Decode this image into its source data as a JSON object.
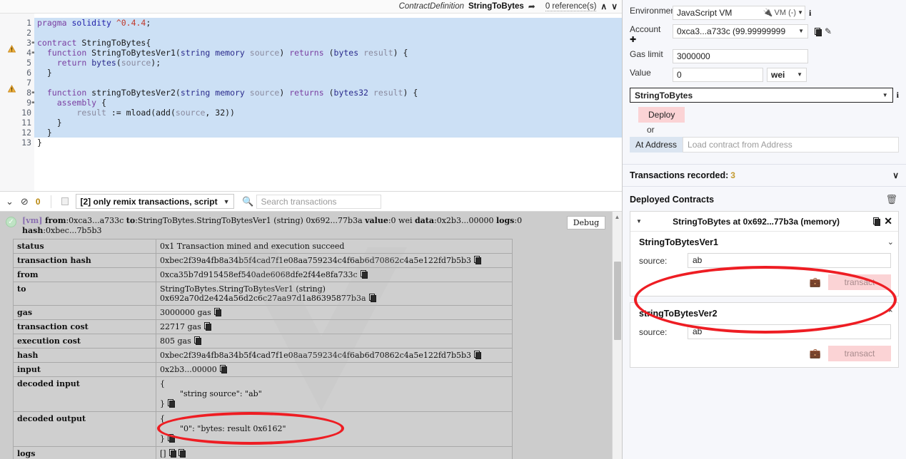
{
  "editor": {
    "context_kind": "ContractDefinition",
    "context_name": "StringToBytes",
    "goto_icon": "arrow-right-icon",
    "references": "0 reference(s)",
    "chevron_up": "∧",
    "chevron_down": "∨",
    "lines": [
      {
        "n": "1",
        "fold": "",
        "warn": false
      },
      {
        "n": "2",
        "fold": "",
        "warn": false
      },
      {
        "n": "3",
        "fold": "-",
        "warn": false
      },
      {
        "n": "4",
        "fold": "-",
        "warn": true
      },
      {
        "n": "5",
        "fold": "",
        "warn": false
      },
      {
        "n": "6",
        "fold": "",
        "warn": false
      },
      {
        "n": "7",
        "fold": "",
        "warn": false
      },
      {
        "n": "8",
        "fold": "-",
        "warn": true
      },
      {
        "n": "9",
        "fold": "-",
        "warn": false
      },
      {
        "n": "10",
        "fold": "",
        "warn": false
      },
      {
        "n": "11",
        "fold": "",
        "warn": false
      },
      {
        "n": "12",
        "fold": "",
        "warn": false
      },
      {
        "n": "13",
        "fold": "",
        "warn": false
      }
    ],
    "code": [
      "pragma solidity ^0.4.4;",
      "",
      "contract StringToBytes{",
      "  function StringToBytesVer1(string memory source) returns (bytes result) {",
      "    return bytes(source);",
      "  }",
      "",
      "  function stringToBytesVer2(string memory source) returns (bytes32 result) {",
      "    assembly {",
      "        result := mload(add(source, 32))",
      "    }",
      "  }",
      "}"
    ]
  },
  "terminal_toolbar": {
    "collapse_icon": "double-chevron-down-icon",
    "clear_icon": "no-entry-icon",
    "pending_count": "0",
    "checkbox_icon": "checkbox-icon",
    "filter_value": "[2] only remix transactions, script",
    "filter_caret": "▼",
    "search_icon": "search-icon",
    "search_placeholder": "Search transactions"
  },
  "transaction": {
    "status_icon": "success-check-icon",
    "vm_tag": "[vm]",
    "from_label": "from",
    "from_value": "0xca3...a733c",
    "to_label": "to",
    "to_value": "StringToBytes.StringToBytesVer1 (string) 0x692...77b3a",
    "value_label": "value",
    "value_value": "0 wei",
    "data_label": "data",
    "data_value": "0x2b3...00000",
    "logs_label": "logs",
    "logs_value": "0",
    "hash_label": "hash",
    "hash_value": "0xbec...7b5b3",
    "debug_button": "Debug",
    "collapse_caret": "∧",
    "rows": [
      {
        "key": "status",
        "value": "0x1 Transaction mined and execution succeed",
        "copy": false
      },
      {
        "key": "transaction hash",
        "value": "0xbec2f39a4fb8a34b5f4cad7f1e08aa759234c4f6ab6d70862c4a5e122fd7b5b3",
        "copy": true
      },
      {
        "key": "from",
        "value": "0xca35b7d915458ef540ade6068dfe2f44e8fa733c",
        "copy": true
      },
      {
        "key": "to",
        "value": "StringToBytes.StringToBytesVer1 (string) 0x692a70d2e424a56d2c6c27aa97d1a86395877b3a",
        "copy": true
      },
      {
        "key": "gas",
        "value": "3000000 gas",
        "copy": true
      },
      {
        "key": "transaction cost",
        "value": "22717 gas",
        "copy": true
      },
      {
        "key": "execution cost",
        "value": "805 gas",
        "copy": true
      },
      {
        "key": "hash",
        "value": "0xbec2f39a4fb8a34b5f4cad7f1e08aa759234c4f6ab6d70862c4a5e122fd7b5b3",
        "copy": true
      },
      {
        "key": "input",
        "value": "0x2b3...00000",
        "copy": true
      },
      {
        "key": "decoded input",
        "value": "{\n        \"string source\": \"ab\"\n}",
        "copy": true
      },
      {
        "key": "decoded output",
        "value": "{\n        \"0\": \"bytes: result 0x6162\"\n}",
        "copy": true
      },
      {
        "key": "logs",
        "value": "[]",
        "copy": true,
        "copy2": true
      }
    ]
  },
  "run_panel": {
    "environment_label": "Environment",
    "environment_value": "JavaScript VM",
    "environment_status": "VM (-)",
    "environment_plug_icon": "plug-icon",
    "environment_info_icon": "info-icon",
    "account_label": "Account",
    "account_add_icon": "plus-circle-icon",
    "account_value": "0xca3...a733c (99.99999999",
    "account_copy_icon": "copy-icon",
    "account_edit_icon": "edit-icon",
    "gas_limit_label": "Gas limit",
    "gas_limit_value": "3000000",
    "value_label": "Value",
    "value_value": "0",
    "value_unit": "wei",
    "caret": "▼",
    "contract_select_value": "StringToBytes",
    "contract_info_icon": "info-icon",
    "deploy_button": "Deploy",
    "or_text": "or",
    "at_address_button": "At Address",
    "at_address_placeholder": "Load contract from Address",
    "transactions_recorded_label": "Transactions recorded:",
    "transactions_recorded_count": "3",
    "transactions_recorded_caret": "∨"
  },
  "deployed": {
    "title": "Deployed Contracts",
    "trash_icon": "trash-icon",
    "card_caret": "▼",
    "card_title": "StringToBytes at 0x692...77b3a (memory)",
    "card_copy_icon": "copy-icon",
    "card_close_icon": "close-icon",
    "functions": [
      {
        "name": "StringToBytesVer1",
        "arg_label": "source:",
        "arg_value": "ab",
        "briefcase_icon": "briefcase-icon",
        "button": "transact",
        "collapse_icon": "chevron-down-icon"
      },
      {
        "name": "stringToBytesVer2",
        "arg_label": "source:",
        "arg_value": "ab",
        "briefcase_icon": "briefcase-icon",
        "button": "transact",
        "collapse_icon": "chevron-up-icon"
      }
    ]
  },
  "colors": {
    "selection": "#cce0f5",
    "accent_pink": "#fbd3d5",
    "annotation_red": "#ee1d23",
    "warning_amber": "#e9a33a",
    "terminal_bg": "#cccccc"
  }
}
